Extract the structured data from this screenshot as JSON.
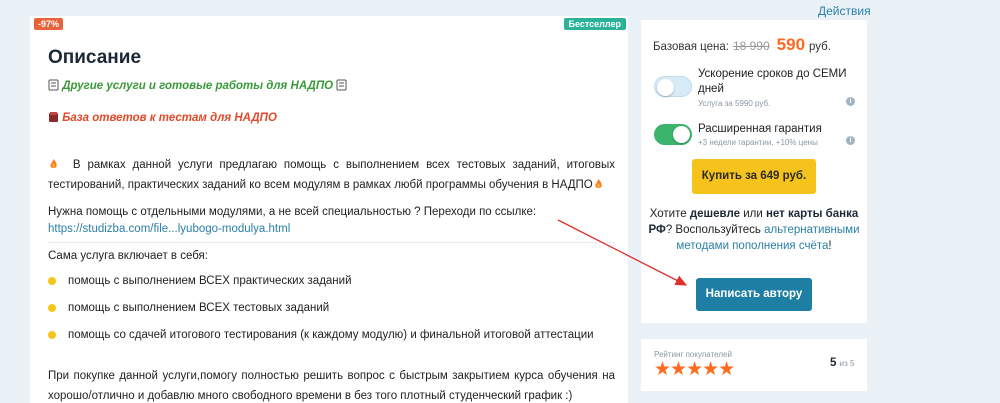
{
  "header": {
    "actions_label": "Действия"
  },
  "main": {
    "badge_discount": "-97%",
    "badge_bestseller": "Бестселлер",
    "title": "Описание",
    "link_other_services": "Другие услуги и готовые работы для НАДПО",
    "link_answers": "База ответов к тестам для НАДПО",
    "intro": "В рамках данной услуги предлагаю помощь с выполнением всех тестовых заданий, итоговых тестирований, практических заданий ко всем модулям в рамках любй программы обучения в НАДПО",
    "modules_prompt": "Нужна помощь с отдельными модулями, а не всей специальностью ? Переходи по ссылке:",
    "modules_url": "https://studizba.com/file...lyubogo-modulya.html",
    "includes_heading": "Сама услуга включает в себя:",
    "includes_items": [
      "помощь с выполнением ВСЕХ практических заданий",
      "помощь с выполнением ВСЕХ тестовых заданий",
      "помощь со сдачей итогового тестирования (к каждому модулю) и финальной итоговой аттестации"
    ],
    "closing": "При покупке данной услуги,помогу полностью решить вопрос с быстрым закрытием курса обучения на хорошо/отлично и добавлю много свободного времени в без того плотный студенческий график :)"
  },
  "purchase": {
    "base_price_label": "Базовая цена:",
    "old_price": "18 990",
    "new_price": "590",
    "currency": "руб.",
    "option_speedup": {
      "label": "Ускорение сроков до СЕМИ дней",
      "sub": "Услуга за 5990 руб.",
      "enabled": false
    },
    "option_warranty": {
      "label": "Расширенная гарантия",
      "sub": "+3 недели гарантии, +10% цены",
      "enabled": true
    },
    "buy_button": "Купить за 649 руб.",
    "help_q1": "Хотите ",
    "help_b1": "дешевле",
    "help_q2": " или ",
    "help_b2": "нет карты банка РФ",
    "help_q3": "? Воспользуйтесь ",
    "help_link": "альтернативными методами пополнения счёта",
    "help_end": "!",
    "write_button": "Написать автору"
  },
  "rating": {
    "label": "Рейтинг покупателей",
    "stars": "★★★★★",
    "value": "5",
    "of_text": "из 5"
  },
  "colors": {
    "accent_blue": "#1f7ea3",
    "price_orange": "#ff6a1f",
    "buy_yellow": "#f6c31d",
    "toggle_green": "#3bb56b"
  }
}
